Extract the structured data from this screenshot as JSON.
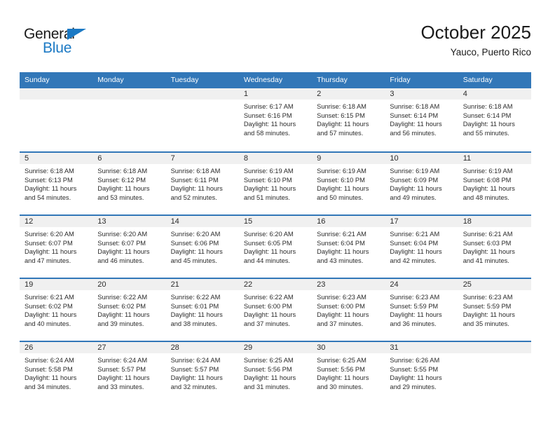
{
  "brand": {
    "name_top": "General",
    "name_bottom": "Blue",
    "accent_color": "#1b79c4"
  },
  "header": {
    "title": "October 2025",
    "subtitle": "Yauco, Puerto Rico"
  },
  "theme": {
    "header_blue": "#3277b8",
    "day_band_gray": "#f0f0f0",
    "text": "#2b2b2b"
  },
  "weekdays": [
    "Sunday",
    "Monday",
    "Tuesday",
    "Wednesday",
    "Thursday",
    "Friday",
    "Saturday"
  ],
  "weeks": [
    [
      {
        "day": "",
        "empty": true
      },
      {
        "day": "",
        "empty": true
      },
      {
        "day": "",
        "empty": true
      },
      {
        "day": "1",
        "sunrise": "Sunrise: 6:17 AM",
        "sunset": "Sunset: 6:16 PM",
        "daylight1": "Daylight: 11 hours",
        "daylight2": "and 58 minutes."
      },
      {
        "day": "2",
        "sunrise": "Sunrise: 6:18 AM",
        "sunset": "Sunset: 6:15 PM",
        "daylight1": "Daylight: 11 hours",
        "daylight2": "and 57 minutes."
      },
      {
        "day": "3",
        "sunrise": "Sunrise: 6:18 AM",
        "sunset": "Sunset: 6:14 PM",
        "daylight1": "Daylight: 11 hours",
        "daylight2": "and 56 minutes."
      },
      {
        "day": "4",
        "sunrise": "Sunrise: 6:18 AM",
        "sunset": "Sunset: 6:14 PM",
        "daylight1": "Daylight: 11 hours",
        "daylight2": "and 55 minutes."
      }
    ],
    [
      {
        "day": "5",
        "sunrise": "Sunrise: 6:18 AM",
        "sunset": "Sunset: 6:13 PM",
        "daylight1": "Daylight: 11 hours",
        "daylight2": "and 54 minutes."
      },
      {
        "day": "6",
        "sunrise": "Sunrise: 6:18 AM",
        "sunset": "Sunset: 6:12 PM",
        "daylight1": "Daylight: 11 hours",
        "daylight2": "and 53 minutes."
      },
      {
        "day": "7",
        "sunrise": "Sunrise: 6:18 AM",
        "sunset": "Sunset: 6:11 PM",
        "daylight1": "Daylight: 11 hours",
        "daylight2": "and 52 minutes."
      },
      {
        "day": "8",
        "sunrise": "Sunrise: 6:19 AM",
        "sunset": "Sunset: 6:10 PM",
        "daylight1": "Daylight: 11 hours",
        "daylight2": "and 51 minutes."
      },
      {
        "day": "9",
        "sunrise": "Sunrise: 6:19 AM",
        "sunset": "Sunset: 6:10 PM",
        "daylight1": "Daylight: 11 hours",
        "daylight2": "and 50 minutes."
      },
      {
        "day": "10",
        "sunrise": "Sunrise: 6:19 AM",
        "sunset": "Sunset: 6:09 PM",
        "daylight1": "Daylight: 11 hours",
        "daylight2": "and 49 minutes."
      },
      {
        "day": "11",
        "sunrise": "Sunrise: 6:19 AM",
        "sunset": "Sunset: 6:08 PM",
        "daylight1": "Daylight: 11 hours",
        "daylight2": "and 48 minutes."
      }
    ],
    [
      {
        "day": "12",
        "sunrise": "Sunrise: 6:20 AM",
        "sunset": "Sunset: 6:07 PM",
        "daylight1": "Daylight: 11 hours",
        "daylight2": "and 47 minutes."
      },
      {
        "day": "13",
        "sunrise": "Sunrise: 6:20 AM",
        "sunset": "Sunset: 6:07 PM",
        "daylight1": "Daylight: 11 hours",
        "daylight2": "and 46 minutes."
      },
      {
        "day": "14",
        "sunrise": "Sunrise: 6:20 AM",
        "sunset": "Sunset: 6:06 PM",
        "daylight1": "Daylight: 11 hours",
        "daylight2": "and 45 minutes."
      },
      {
        "day": "15",
        "sunrise": "Sunrise: 6:20 AM",
        "sunset": "Sunset: 6:05 PM",
        "daylight1": "Daylight: 11 hours",
        "daylight2": "and 44 minutes."
      },
      {
        "day": "16",
        "sunrise": "Sunrise: 6:21 AM",
        "sunset": "Sunset: 6:04 PM",
        "daylight1": "Daylight: 11 hours",
        "daylight2": "and 43 minutes."
      },
      {
        "day": "17",
        "sunrise": "Sunrise: 6:21 AM",
        "sunset": "Sunset: 6:04 PM",
        "daylight1": "Daylight: 11 hours",
        "daylight2": "and 42 minutes."
      },
      {
        "day": "18",
        "sunrise": "Sunrise: 6:21 AM",
        "sunset": "Sunset: 6:03 PM",
        "daylight1": "Daylight: 11 hours",
        "daylight2": "and 41 minutes."
      }
    ],
    [
      {
        "day": "19",
        "sunrise": "Sunrise: 6:21 AM",
        "sunset": "Sunset: 6:02 PM",
        "daylight1": "Daylight: 11 hours",
        "daylight2": "and 40 minutes."
      },
      {
        "day": "20",
        "sunrise": "Sunrise: 6:22 AM",
        "sunset": "Sunset: 6:02 PM",
        "daylight1": "Daylight: 11 hours",
        "daylight2": "and 39 minutes."
      },
      {
        "day": "21",
        "sunrise": "Sunrise: 6:22 AM",
        "sunset": "Sunset: 6:01 PM",
        "daylight1": "Daylight: 11 hours",
        "daylight2": "and 38 minutes."
      },
      {
        "day": "22",
        "sunrise": "Sunrise: 6:22 AM",
        "sunset": "Sunset: 6:00 PM",
        "daylight1": "Daylight: 11 hours",
        "daylight2": "and 37 minutes."
      },
      {
        "day": "23",
        "sunrise": "Sunrise: 6:23 AM",
        "sunset": "Sunset: 6:00 PM",
        "daylight1": "Daylight: 11 hours",
        "daylight2": "and 37 minutes."
      },
      {
        "day": "24",
        "sunrise": "Sunrise: 6:23 AM",
        "sunset": "Sunset: 5:59 PM",
        "daylight1": "Daylight: 11 hours",
        "daylight2": "and 36 minutes."
      },
      {
        "day": "25",
        "sunrise": "Sunrise: 6:23 AM",
        "sunset": "Sunset: 5:59 PM",
        "daylight1": "Daylight: 11 hours",
        "daylight2": "and 35 minutes."
      }
    ],
    [
      {
        "day": "26",
        "sunrise": "Sunrise: 6:24 AM",
        "sunset": "Sunset: 5:58 PM",
        "daylight1": "Daylight: 11 hours",
        "daylight2": "and 34 minutes."
      },
      {
        "day": "27",
        "sunrise": "Sunrise: 6:24 AM",
        "sunset": "Sunset: 5:57 PM",
        "daylight1": "Daylight: 11 hours",
        "daylight2": "and 33 minutes."
      },
      {
        "day": "28",
        "sunrise": "Sunrise: 6:24 AM",
        "sunset": "Sunset: 5:57 PM",
        "daylight1": "Daylight: 11 hours",
        "daylight2": "and 32 minutes."
      },
      {
        "day": "29",
        "sunrise": "Sunrise: 6:25 AM",
        "sunset": "Sunset: 5:56 PM",
        "daylight1": "Daylight: 11 hours",
        "daylight2": "and 31 minutes."
      },
      {
        "day": "30",
        "sunrise": "Sunrise: 6:25 AM",
        "sunset": "Sunset: 5:56 PM",
        "daylight1": "Daylight: 11 hours",
        "daylight2": "and 30 minutes."
      },
      {
        "day": "31",
        "sunrise": "Sunrise: 6:26 AM",
        "sunset": "Sunset: 5:55 PM",
        "daylight1": "Daylight: 11 hours",
        "daylight2": "and 29 minutes."
      },
      {
        "day": "",
        "empty": true
      }
    ]
  ]
}
